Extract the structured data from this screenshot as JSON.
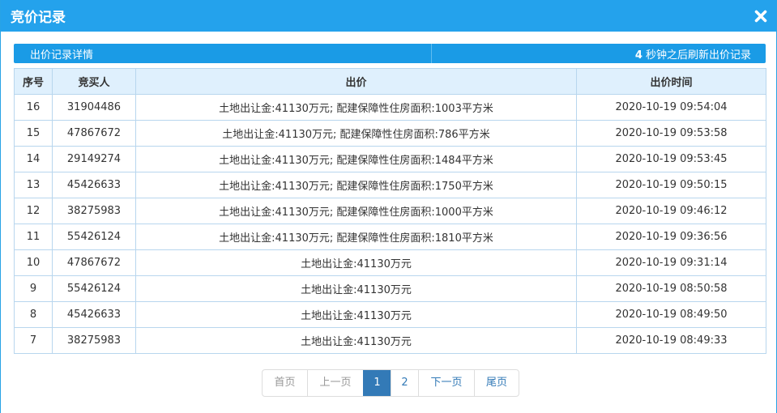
{
  "dialog": {
    "title": "竞价记录",
    "close_icon": "close-icon"
  },
  "infobar": {
    "left_text": "出价记录详情",
    "countdown": "4",
    "refresh_text": " 秒钟之后刷新出价记录"
  },
  "table": {
    "headers": [
      "序号",
      "竞买人",
      "出价",
      "出价时间"
    ],
    "rows": [
      {
        "seq": "16",
        "bidder": "31904486",
        "bid": "土地出让金:41130万元; 配建保障性住房面积:1003平方米",
        "time": "2020-10-19 09:54:04"
      },
      {
        "seq": "15",
        "bidder": "47867672",
        "bid": "土地出让金:41130万元; 配建保障性住房面积:786平方米",
        "time": "2020-10-19 09:53:58"
      },
      {
        "seq": "14",
        "bidder": "29149274",
        "bid": "土地出让金:41130万元; 配建保障性住房面积:1484平方米",
        "time": "2020-10-19 09:53:45"
      },
      {
        "seq": "13",
        "bidder": "45426633",
        "bid": "土地出让金:41130万元; 配建保障性住房面积:1750平方米",
        "time": "2020-10-19 09:50:15"
      },
      {
        "seq": "12",
        "bidder": "38275983",
        "bid": "土地出让金:41130万元; 配建保障性住房面积:1000平方米",
        "time": "2020-10-19 09:46:12"
      },
      {
        "seq": "11",
        "bidder": "55426124",
        "bid": "土地出让金:41130万元; 配建保障性住房面积:1810平方米",
        "time": "2020-10-19 09:36:56"
      },
      {
        "seq": "10",
        "bidder": "47867672",
        "bid": "土地出让金:41130万元",
        "time": "2020-10-19 09:31:14"
      },
      {
        "seq": "9",
        "bidder": "55426124",
        "bid": "土地出让金:41130万元",
        "time": "2020-10-19 08:50:58"
      },
      {
        "seq": "8",
        "bidder": "45426633",
        "bid": "土地出让金:41130万元",
        "time": "2020-10-19 08:49:50"
      },
      {
        "seq": "7",
        "bidder": "38275983",
        "bid": "土地出让金:41130万元",
        "time": "2020-10-19 08:49:33"
      }
    ]
  },
  "pagination": {
    "first": "首页",
    "prev": "上一页",
    "pages": [
      "1",
      "2"
    ],
    "current": "1",
    "next": "下一页",
    "last": "尾页"
  },
  "colors": {
    "title_bar": "#24a2ec",
    "info_bar": "#1a9be6",
    "header_bg": "#dff0fd",
    "border": "#b8d6ee",
    "active_page": "#337ab7"
  }
}
